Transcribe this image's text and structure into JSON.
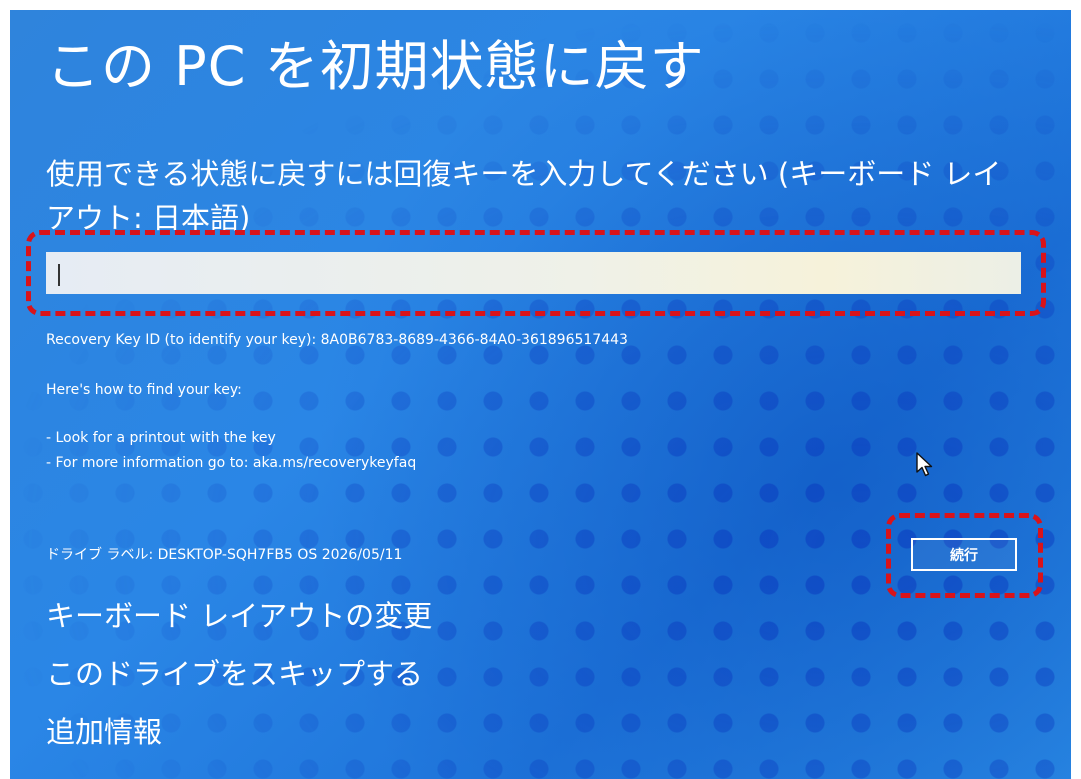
{
  "header": {
    "title": "この PC を初期状態に戻す"
  },
  "prompt": {
    "text": "使用できる状態に戻すには回復キーを入力してください (キーボード レイアウト: 日本語)"
  },
  "recovery_input": {
    "value": "",
    "placeholder": ""
  },
  "info": {
    "recovery_key_id": "Recovery Key ID (to identify your key): 8A0B6783-8689-4366-84A0-361896517443",
    "how_to": "Here's how to find your key:",
    "tips": [
      "- Look for a printout with the key",
      "- For more information go to: aka.ms/recoverykeyfaq"
    ],
    "drive_label": "ドライブ ラベル: DESKTOP-SQH7FB5 OS 2026/05/11"
  },
  "actions": {
    "continue_label": "続行"
  },
  "links": {
    "change_keyboard_layout": "キーボード レイアウトの変更",
    "skip_drive": "このドライブをスキップする",
    "more_info": "追加情報"
  },
  "colors": {
    "background": "#2a86e6",
    "highlight": "#d9131a",
    "text": "#ffffff"
  },
  "icons": {
    "cursor": "mouse-pointer-icon"
  }
}
